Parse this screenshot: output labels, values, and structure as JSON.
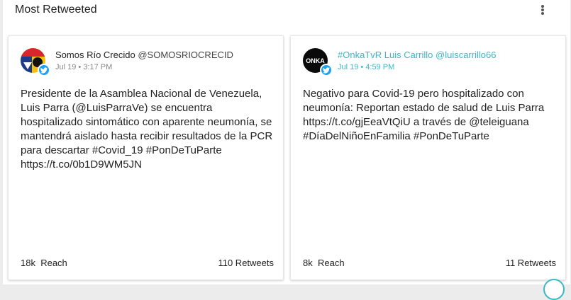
{
  "panel": {
    "title": "Most Retweeted",
    "menu_icon": "more-vertical-icon"
  },
  "tweets": [
    {
      "author_name": "Somos Río Crecido",
      "handle": "@SOMOSRIOCRECID",
      "time": "Jul 19 • 3:17 PM",
      "text": "Presidente de la Asamblea Nacional de Venezuela, Luis Parra (@LuisParraVe) se encuentra hospitalizado sintomático con aparente neumonía, se mantendrá aislado hasta recibir resultados de la PCR para descartar #Covid_19 #PonDeTuParte https://t.co/0b1D9WM5JN",
      "reach": "18k",
      "reach_label": "Reach",
      "retweets": "110 Retweets",
      "source_icon": "twitter-icon"
    },
    {
      "author_name": "#OnkaTvR Luis Carrillo",
      "handle": "@luiscarrillo66",
      "time": "Jul 19 • 4:59 PM",
      "text": "Negativo para Covid-19 pero hospitalizado con neumonía: Reportan estado de salud de Luis Parra https://t.co/gjEeaVtQiU a través de @teleiguana #DíaDelNiñoEnFamilia #PonDeTuParte",
      "reach": "8k",
      "reach_label": "Reach",
      "retweets": "11 Retweets",
      "source_icon": "twitter-icon"
    }
  ],
  "colors": {
    "accent": "#3bb8c6",
    "twitter": "#1da1f2"
  }
}
